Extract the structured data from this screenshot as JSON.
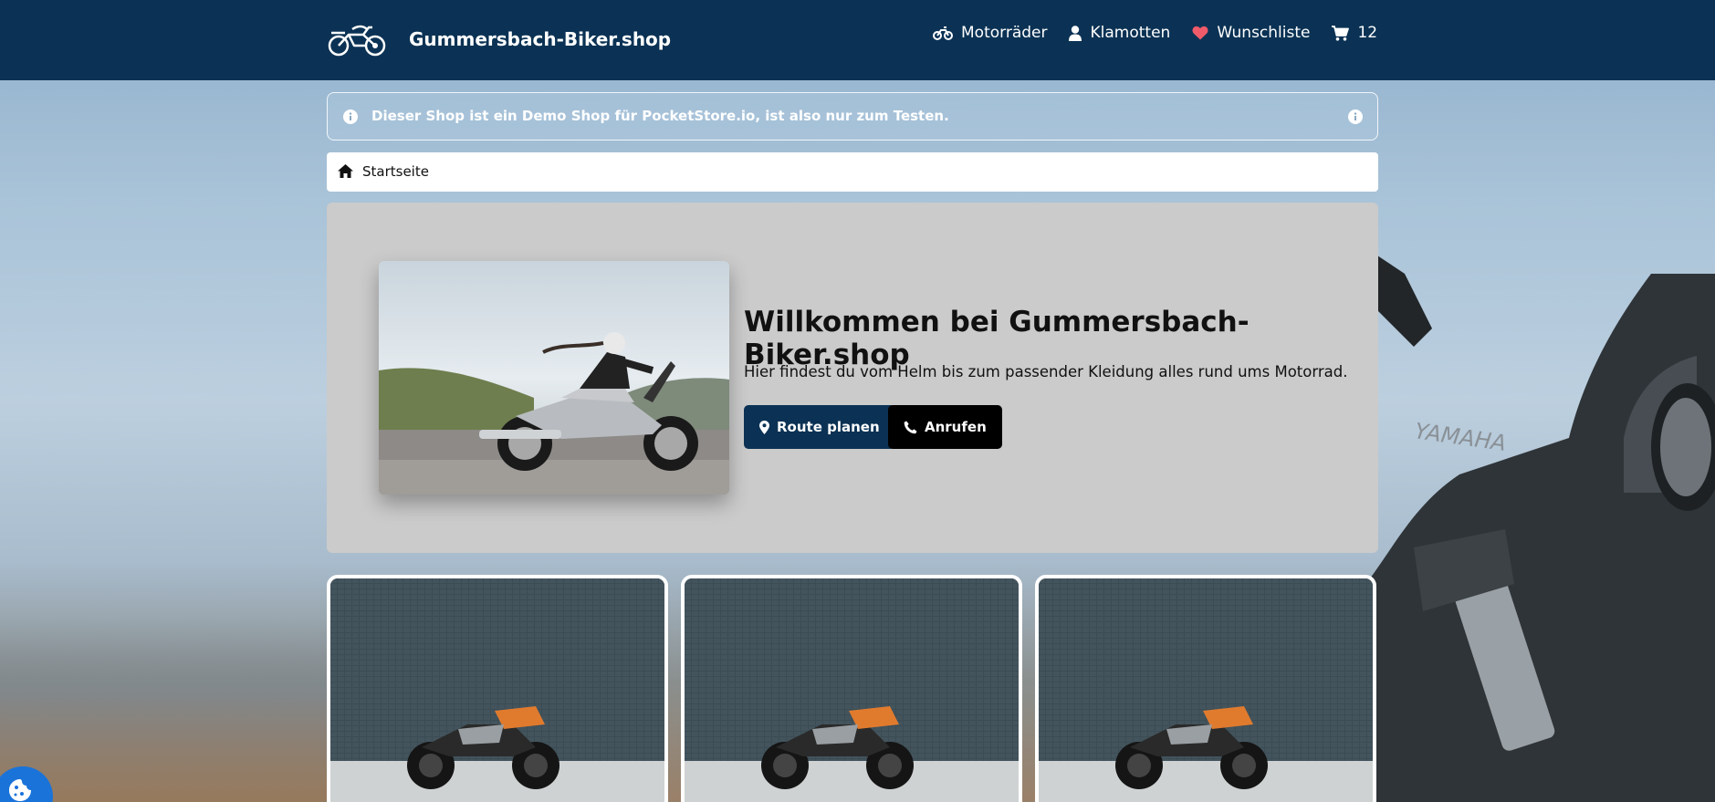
{
  "header": {
    "brand": "Gummersbach-Biker.shop",
    "logo_icon": "motorcycle-icon",
    "nav": [
      {
        "label": "Motorräder",
        "icon": "motorcycle-icon"
      },
      {
        "label": "Klamotten",
        "icon": "user-icon"
      },
      {
        "label": "Wunschliste",
        "icon": "heart-icon"
      },
      {
        "label": "12",
        "icon": "cart-icon"
      }
    ]
  },
  "info": {
    "text": "Dieser Shop ist ein Demo Shop für PocketStore.io, ist also nur zum Testen.",
    "icon": "info-icon"
  },
  "breadcrumb": {
    "home": "Startseite",
    "icon": "home-icon"
  },
  "hero": {
    "title": "Willkommen bei Gummersbach-Biker.shop",
    "subtitle": "Hier findest du vom Helm bis zum passender Kleidung alles rund ums Motorrad.",
    "route_button": "Route planen",
    "call_button": "Anrufen"
  },
  "colors": {
    "header_bg": "#0b3254",
    "hero_bg": "#cbcbcb",
    "accent": "#0b3254",
    "heart": "#ef5b6a",
    "cookie": "#1a73d9"
  },
  "products": [
    {
      "image": "motorcycle-photo"
    },
    {
      "image": "motorcycle-photo"
    },
    {
      "image": "motorcycle-photo"
    }
  ]
}
